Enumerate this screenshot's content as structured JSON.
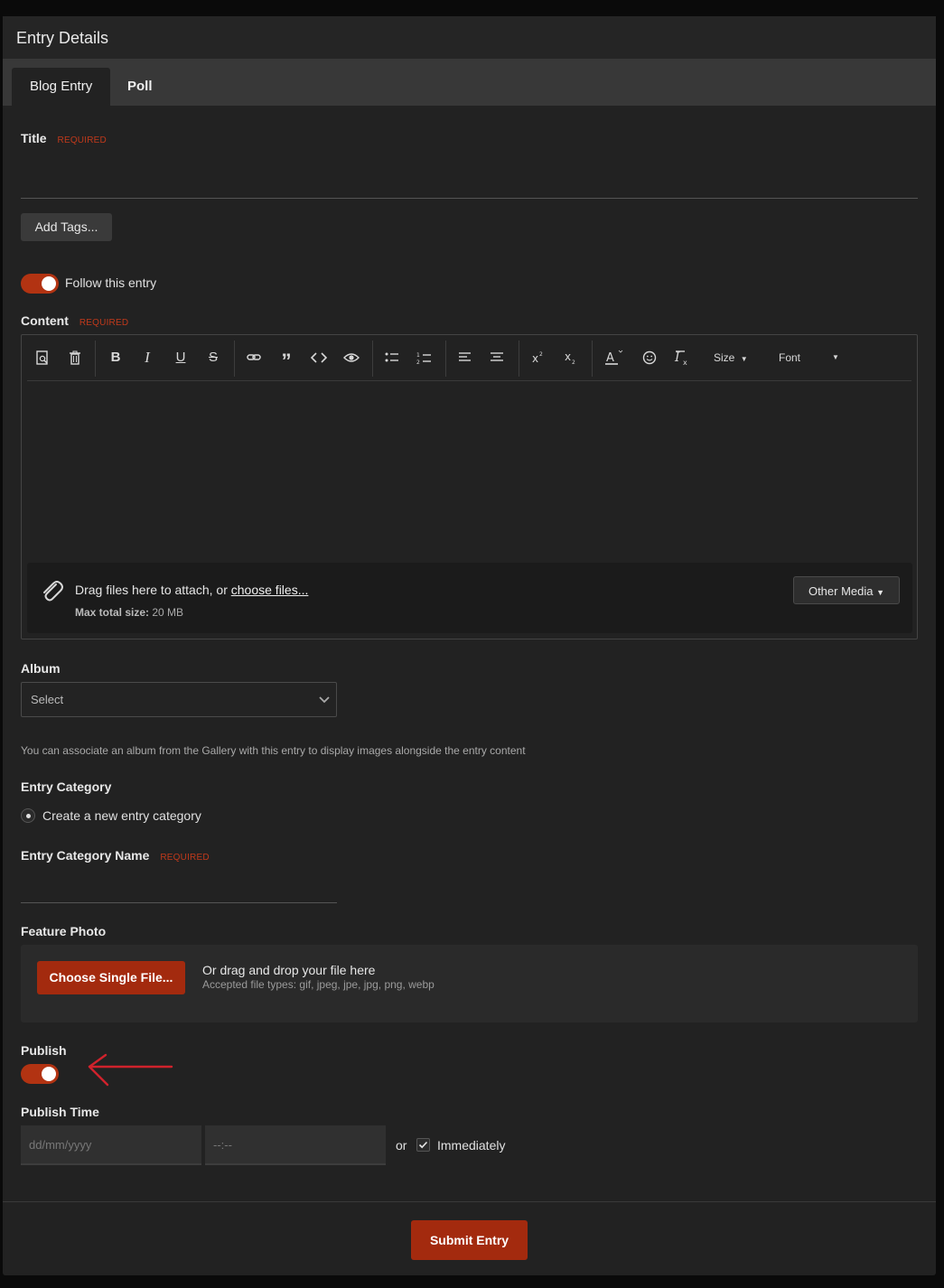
{
  "header": {
    "title": "Entry Details"
  },
  "tabs": [
    {
      "label": "Blog Entry"
    },
    {
      "label": "Poll"
    }
  ],
  "title_field": {
    "label": "Title",
    "required": "REQUIRED",
    "value": ""
  },
  "tags": {
    "button_label": "Add Tags..."
  },
  "follow": {
    "label": "Follow this entry",
    "on": true
  },
  "content": {
    "label": "Content",
    "required": "REQUIRED",
    "toolbar": {
      "size_label": "Size",
      "font_label": "Font"
    },
    "attach": {
      "prefix": "Drag files here to attach, or ",
      "link": "choose files...",
      "max_label": "Max total size:",
      "max_value": "20 MB",
      "other_media": "Other Media"
    }
  },
  "album": {
    "label": "Album",
    "selected": "Select",
    "help": "You can associate an album from the Gallery with this entry to display images alongside the entry content"
  },
  "category": {
    "label": "Entry Category",
    "option": "Create a new entry category"
  },
  "category_name": {
    "label": "Entry Category Name",
    "required": "REQUIRED",
    "value": ""
  },
  "feature_photo": {
    "label": "Feature Photo",
    "button": "Choose Single File...",
    "drag_text": "Or drag and drop your file here",
    "accepted": "Accepted file types: gif, jpeg, jpe, jpg, png, webp"
  },
  "publish": {
    "label": "Publish",
    "on": true
  },
  "publish_time": {
    "label": "Publish Time",
    "date_placeholder": "dd/mm/yyyy",
    "time_placeholder": "--:--",
    "or": "or",
    "immediately": "Immediately",
    "immediately_checked": true
  },
  "submit": {
    "label": "Submit Entry"
  },
  "colors": {
    "accent": "#a32a0e",
    "panel": "#222222",
    "tabbar": "#383838",
    "annotation": "#d0222c"
  }
}
